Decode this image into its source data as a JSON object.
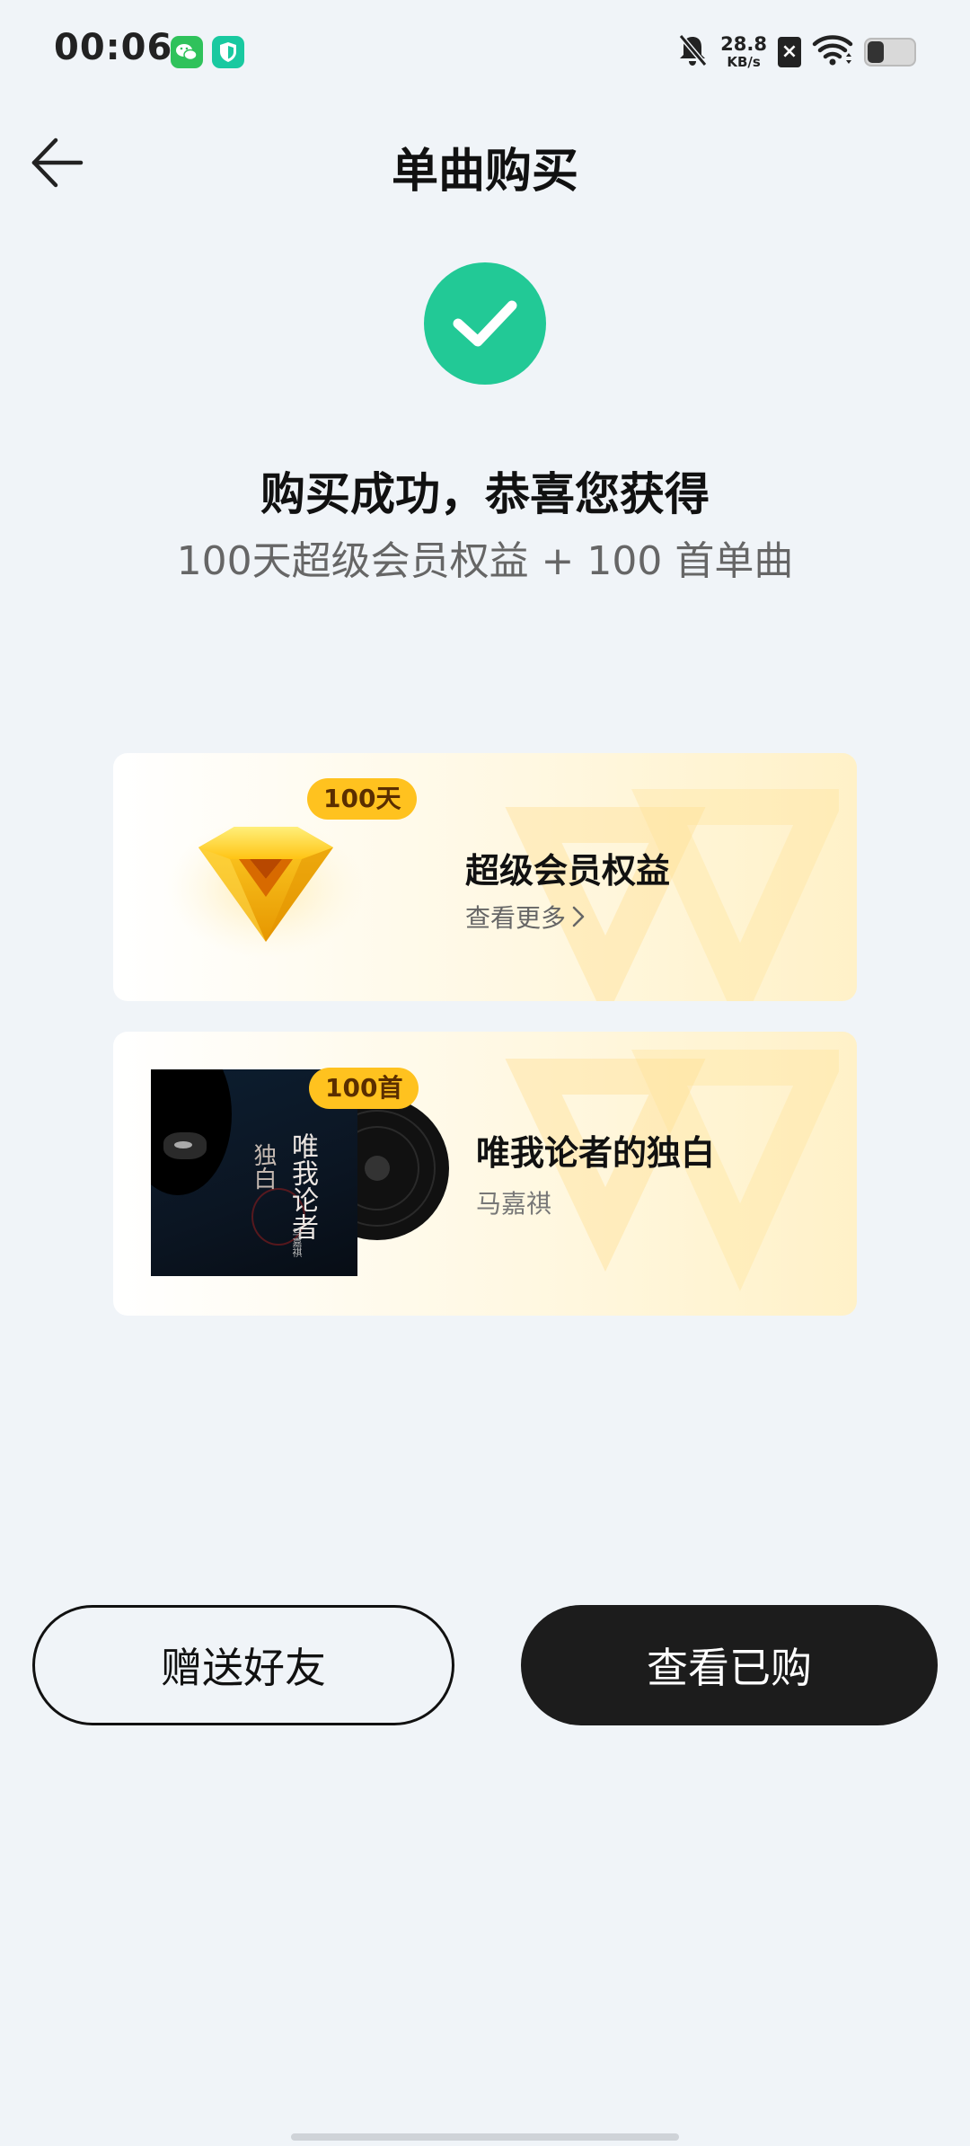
{
  "status_bar": {
    "time": "00:06",
    "network_speed_value": "28.8",
    "network_speed_unit": "KB/s",
    "battery_level": 0.35,
    "icons": [
      "wechat-icon",
      "shield-icon",
      "mute-bell-icon",
      "sim-x-icon",
      "wifi-icon",
      "battery-icon"
    ]
  },
  "header": {
    "title": "单曲购买"
  },
  "success": {
    "title": "购买成功，恭喜您获得",
    "subtitle": "100天超级会员权益 + 100 首单曲"
  },
  "vip_card": {
    "badge": "100天",
    "title": "超级会员权益",
    "link": "查看更多"
  },
  "song_card": {
    "badge": "100首",
    "title": "唯我论者的独白",
    "artist": "马嘉祺",
    "cover_title": "唯我论者",
    "cover_side_text": "独白",
    "cover_artist": "马嘉祺"
  },
  "buttons": {
    "gift": "赠送好友",
    "view_purchased": "查看已购"
  },
  "colors": {
    "background": "#f0f4f8",
    "success_green": "#22c996",
    "badge_yellow": "#ffc21f",
    "dark_button": "#1c1c1c"
  }
}
